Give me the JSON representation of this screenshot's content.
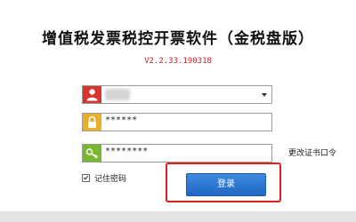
{
  "title": "增值税发票税控开票软件（金税盘版）",
  "version": "V2.2.33.190318",
  "fields": {
    "user": {
      "icon": "user-icon",
      "value": ""
    },
    "password": {
      "icon": "lock-icon",
      "value": "******"
    },
    "cert_password": {
      "icon": "key-icon",
      "value": "********"
    }
  },
  "change_cert_label": "更改证书口令",
  "remember": {
    "label": "记住密码",
    "checked": true
  },
  "login_label": "登录",
  "colors": {
    "accent_button": "#2a74d4",
    "highlight_border": "#e0201c",
    "version_text": "#cc2020",
    "user_icon_bg": "#d9342c",
    "lock_icon_bg": "#e9ae2a",
    "key_icon_bg": "#79b82e"
  }
}
